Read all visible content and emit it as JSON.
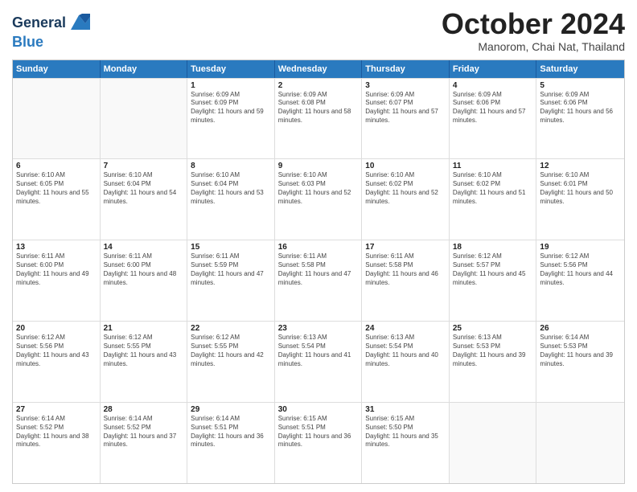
{
  "logo": {
    "line1": "General",
    "line2": "Blue"
  },
  "title": "October 2024",
  "subtitle": "Manorom, Chai Nat, Thailand",
  "header_days": [
    "Sunday",
    "Monday",
    "Tuesday",
    "Wednesday",
    "Thursday",
    "Friday",
    "Saturday"
  ],
  "weeks": [
    [
      {
        "day": "",
        "sunrise": "",
        "sunset": "",
        "daylight": ""
      },
      {
        "day": "",
        "sunrise": "",
        "sunset": "",
        "daylight": ""
      },
      {
        "day": "1",
        "sunrise": "Sunrise: 6:09 AM",
        "sunset": "Sunset: 6:09 PM",
        "daylight": "Daylight: 11 hours and 59 minutes."
      },
      {
        "day": "2",
        "sunrise": "Sunrise: 6:09 AM",
        "sunset": "Sunset: 6:08 PM",
        "daylight": "Daylight: 11 hours and 58 minutes."
      },
      {
        "day": "3",
        "sunrise": "Sunrise: 6:09 AM",
        "sunset": "Sunset: 6:07 PM",
        "daylight": "Daylight: 11 hours and 57 minutes."
      },
      {
        "day": "4",
        "sunrise": "Sunrise: 6:09 AM",
        "sunset": "Sunset: 6:06 PM",
        "daylight": "Daylight: 11 hours and 57 minutes."
      },
      {
        "day": "5",
        "sunrise": "Sunrise: 6:09 AM",
        "sunset": "Sunset: 6:06 PM",
        "daylight": "Daylight: 11 hours and 56 minutes."
      }
    ],
    [
      {
        "day": "6",
        "sunrise": "Sunrise: 6:10 AM",
        "sunset": "Sunset: 6:05 PM",
        "daylight": "Daylight: 11 hours and 55 minutes."
      },
      {
        "day": "7",
        "sunrise": "Sunrise: 6:10 AM",
        "sunset": "Sunset: 6:04 PM",
        "daylight": "Daylight: 11 hours and 54 minutes."
      },
      {
        "day": "8",
        "sunrise": "Sunrise: 6:10 AM",
        "sunset": "Sunset: 6:04 PM",
        "daylight": "Daylight: 11 hours and 53 minutes."
      },
      {
        "day": "9",
        "sunrise": "Sunrise: 6:10 AM",
        "sunset": "Sunset: 6:03 PM",
        "daylight": "Daylight: 11 hours and 52 minutes."
      },
      {
        "day": "10",
        "sunrise": "Sunrise: 6:10 AM",
        "sunset": "Sunset: 6:02 PM",
        "daylight": "Daylight: 11 hours and 52 minutes."
      },
      {
        "day": "11",
        "sunrise": "Sunrise: 6:10 AM",
        "sunset": "Sunset: 6:02 PM",
        "daylight": "Daylight: 11 hours and 51 minutes."
      },
      {
        "day": "12",
        "sunrise": "Sunrise: 6:10 AM",
        "sunset": "Sunset: 6:01 PM",
        "daylight": "Daylight: 11 hours and 50 minutes."
      }
    ],
    [
      {
        "day": "13",
        "sunrise": "Sunrise: 6:11 AM",
        "sunset": "Sunset: 6:00 PM",
        "daylight": "Daylight: 11 hours and 49 minutes."
      },
      {
        "day": "14",
        "sunrise": "Sunrise: 6:11 AM",
        "sunset": "Sunset: 6:00 PM",
        "daylight": "Daylight: 11 hours and 48 minutes."
      },
      {
        "day": "15",
        "sunrise": "Sunrise: 6:11 AM",
        "sunset": "Sunset: 5:59 PM",
        "daylight": "Daylight: 11 hours and 47 minutes."
      },
      {
        "day": "16",
        "sunrise": "Sunrise: 6:11 AM",
        "sunset": "Sunset: 5:58 PM",
        "daylight": "Daylight: 11 hours and 47 minutes."
      },
      {
        "day": "17",
        "sunrise": "Sunrise: 6:11 AM",
        "sunset": "Sunset: 5:58 PM",
        "daylight": "Daylight: 11 hours and 46 minutes."
      },
      {
        "day": "18",
        "sunrise": "Sunrise: 6:12 AM",
        "sunset": "Sunset: 5:57 PM",
        "daylight": "Daylight: 11 hours and 45 minutes."
      },
      {
        "day": "19",
        "sunrise": "Sunrise: 6:12 AM",
        "sunset": "Sunset: 5:56 PM",
        "daylight": "Daylight: 11 hours and 44 minutes."
      }
    ],
    [
      {
        "day": "20",
        "sunrise": "Sunrise: 6:12 AM",
        "sunset": "Sunset: 5:56 PM",
        "daylight": "Daylight: 11 hours and 43 minutes."
      },
      {
        "day": "21",
        "sunrise": "Sunrise: 6:12 AM",
        "sunset": "Sunset: 5:55 PM",
        "daylight": "Daylight: 11 hours and 43 minutes."
      },
      {
        "day": "22",
        "sunrise": "Sunrise: 6:12 AM",
        "sunset": "Sunset: 5:55 PM",
        "daylight": "Daylight: 11 hours and 42 minutes."
      },
      {
        "day": "23",
        "sunrise": "Sunrise: 6:13 AM",
        "sunset": "Sunset: 5:54 PM",
        "daylight": "Daylight: 11 hours and 41 minutes."
      },
      {
        "day": "24",
        "sunrise": "Sunrise: 6:13 AM",
        "sunset": "Sunset: 5:54 PM",
        "daylight": "Daylight: 11 hours and 40 minutes."
      },
      {
        "day": "25",
        "sunrise": "Sunrise: 6:13 AM",
        "sunset": "Sunset: 5:53 PM",
        "daylight": "Daylight: 11 hours and 39 minutes."
      },
      {
        "day": "26",
        "sunrise": "Sunrise: 6:14 AM",
        "sunset": "Sunset: 5:53 PM",
        "daylight": "Daylight: 11 hours and 39 minutes."
      }
    ],
    [
      {
        "day": "27",
        "sunrise": "Sunrise: 6:14 AM",
        "sunset": "Sunset: 5:52 PM",
        "daylight": "Daylight: 11 hours and 38 minutes."
      },
      {
        "day": "28",
        "sunrise": "Sunrise: 6:14 AM",
        "sunset": "Sunset: 5:52 PM",
        "daylight": "Daylight: 11 hours and 37 minutes."
      },
      {
        "day": "29",
        "sunrise": "Sunrise: 6:14 AM",
        "sunset": "Sunset: 5:51 PM",
        "daylight": "Daylight: 11 hours and 36 minutes."
      },
      {
        "day": "30",
        "sunrise": "Sunrise: 6:15 AM",
        "sunset": "Sunset: 5:51 PM",
        "daylight": "Daylight: 11 hours and 36 minutes."
      },
      {
        "day": "31",
        "sunrise": "Sunrise: 6:15 AM",
        "sunset": "Sunset: 5:50 PM",
        "daylight": "Daylight: 11 hours and 35 minutes."
      },
      {
        "day": "",
        "sunrise": "",
        "sunset": "",
        "daylight": ""
      },
      {
        "day": "",
        "sunrise": "",
        "sunset": "",
        "daylight": ""
      }
    ]
  ]
}
